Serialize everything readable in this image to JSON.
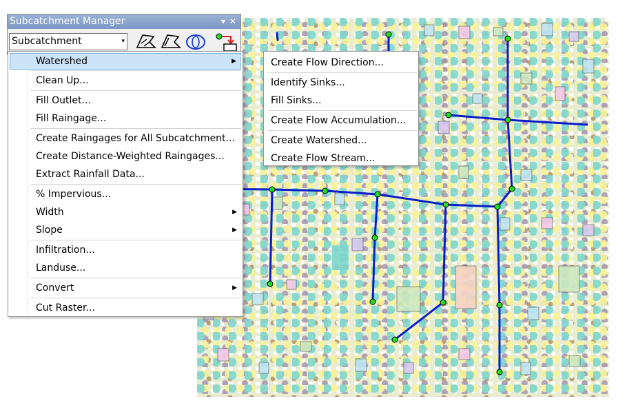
{
  "window": {
    "title": "Subcatchment Manager",
    "pin_glyph": "▾",
    "close_glyph": "✕"
  },
  "toolbar": {
    "dropdown_label": "Subcatchment Manager",
    "dropdown_arrow": "▾",
    "buttons": [
      {
        "icon": "flow-shape-icon"
      },
      {
        "icon": "flow-shape-outline-icon"
      },
      {
        "icon": "ellipse-select-icon"
      },
      {
        "icon": "node-link-icon"
      }
    ]
  },
  "menu": {
    "items": [
      {
        "label": "Watershed",
        "has_submenu": true
      },
      {
        "label": "Clean Up..."
      },
      {
        "label": "Fill Outlet..."
      },
      {
        "label": "Fill Raingage..."
      },
      {
        "label": "Create Raingages for All Subcatchment..."
      },
      {
        "label": "Create Distance-Weighted Raingages..."
      },
      {
        "label": "Extract Rainfall Data..."
      },
      {
        "label": "% Impervious..."
      },
      {
        "label": "Width",
        "has_submenu": true
      },
      {
        "label": "Slope",
        "has_submenu": true
      },
      {
        "label": "Infiltration..."
      },
      {
        "label": "Landuse..."
      },
      {
        "label": "Convert",
        "has_submenu": true
      },
      {
        "label": "Cut Raster..."
      }
    ],
    "submenu_arrow": "▶"
  },
  "submenu": {
    "items": [
      {
        "label": "Create Flow Direction..."
      },
      {
        "label": "Identify Sinks..."
      },
      {
        "label": "Fill Sinks..."
      },
      {
        "label": "Create Flow Accumulation..."
      },
      {
        "label": "Create Watershed..."
      },
      {
        "label": "Create Flow Stream..."
      }
    ]
  },
  "colors": {
    "stream": "#0a1ec8",
    "node_fill": "#22dd22",
    "menu_highlight": "#cce4f8",
    "titlebar": "#8aa5cf"
  }
}
